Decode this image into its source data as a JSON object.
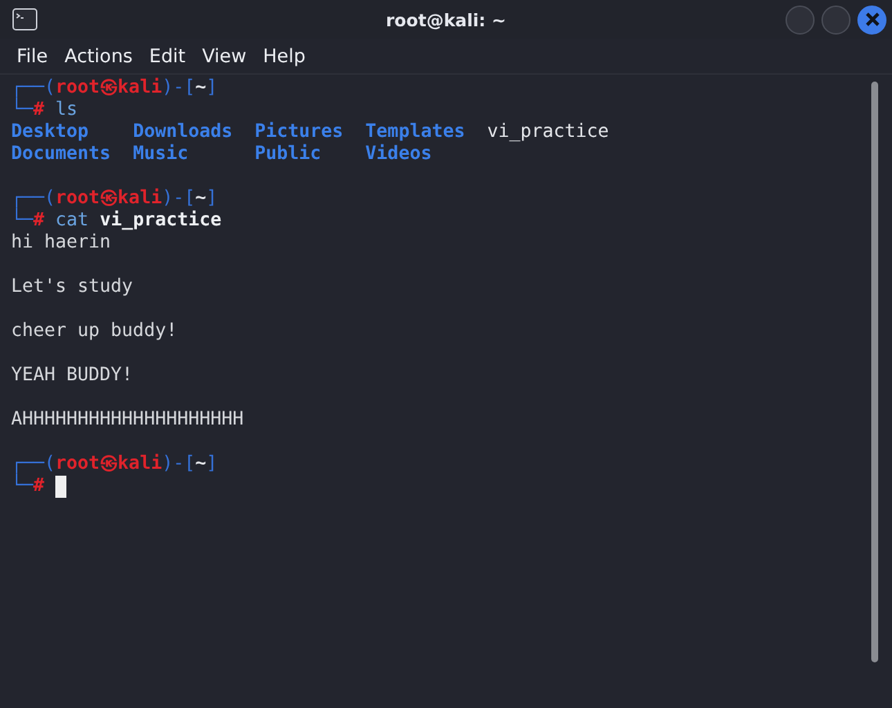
{
  "window": {
    "title": "root@kali: ~"
  },
  "menu": [
    "File",
    "Actions",
    "Edit",
    "View",
    "Help"
  ],
  "terminal": [
    {
      "kind": "prompt",
      "open": "┌──(",
      "user": "root",
      "at": "㉿",
      "host": "kali",
      "mid": ")-[",
      "cwd": "~",
      "close": "]",
      "corner": "└─",
      "sign": "#",
      "command": "ls",
      "cursor": false
    },
    {
      "kind": "listing",
      "rows": [
        [
          {
            "name": "Desktop",
            "directory": true
          },
          {
            "name": "Downloads",
            "directory": true
          },
          {
            "name": "Pictures",
            "directory": true
          },
          {
            "name": "Templates",
            "directory": true
          },
          {
            "name": "vi_practice",
            "directory": false
          }
        ],
        [
          {
            "name": "Documents",
            "directory": true
          },
          {
            "name": "Music",
            "directory": true
          },
          {
            "name": "Public",
            "directory": true
          },
          {
            "name": "Videos",
            "directory": true
          }
        ]
      ]
    },
    {
      "kind": "blank"
    },
    {
      "kind": "prompt",
      "open": "┌──(",
      "user": "root",
      "at": "㉿",
      "host": "kali",
      "mid": ")-[",
      "cwd": "~",
      "close": "]",
      "corner": "└─",
      "sign": "#",
      "command": "cat",
      "argument": "vi_practice",
      "cursor": false
    },
    {
      "kind": "output",
      "text": "hi haerin"
    },
    {
      "kind": "blank"
    },
    {
      "kind": "output",
      "text": "Let's study"
    },
    {
      "kind": "blank"
    },
    {
      "kind": "output",
      "text": "cheer up buddy!"
    },
    {
      "kind": "blank"
    },
    {
      "kind": "output",
      "text": "YEAH BUDDY!"
    },
    {
      "kind": "blank"
    },
    {
      "kind": "output",
      "text": "AHHHHHHHHHHHHHHHHHHHH"
    },
    {
      "kind": "blank"
    },
    {
      "kind": "prompt",
      "open": "┌──(",
      "user": "root",
      "at": "㉿",
      "host": "kali",
      "mid": ")-[",
      "cwd": "~",
      "close": "]",
      "corner": "└─",
      "sign": "#",
      "cursor": true
    }
  ]
}
